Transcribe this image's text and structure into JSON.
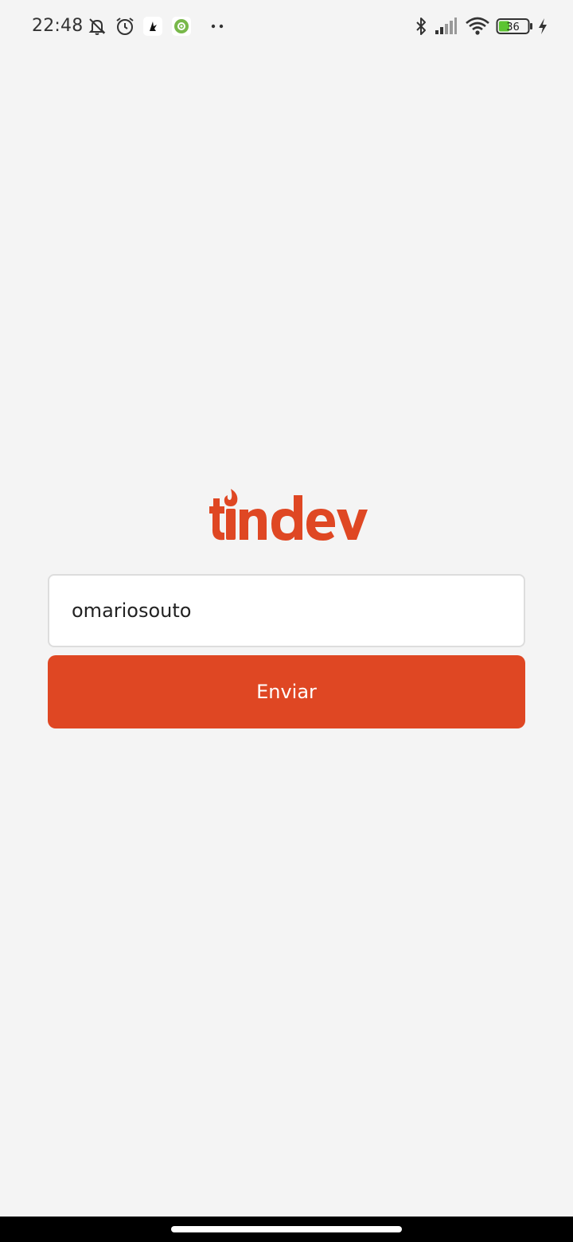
{
  "status_bar": {
    "time": "22:48",
    "battery_level": "36",
    "left_icons": [
      "mute-notifications-icon",
      "alarm-icon",
      "app-notification-icon",
      "android-settings-icon",
      "more-dots-icon"
    ],
    "right_icons": [
      "bluetooth-icon",
      "signal-icon",
      "wifi-icon",
      "battery-icon",
      "charging-icon"
    ]
  },
  "logo": {
    "text": "tindev",
    "color": "#df4723"
  },
  "login": {
    "username_value": "omariosouto",
    "submit_label": "Enviar"
  },
  "colors": {
    "accent": "#df4723",
    "background": "#f4f4f4"
  }
}
